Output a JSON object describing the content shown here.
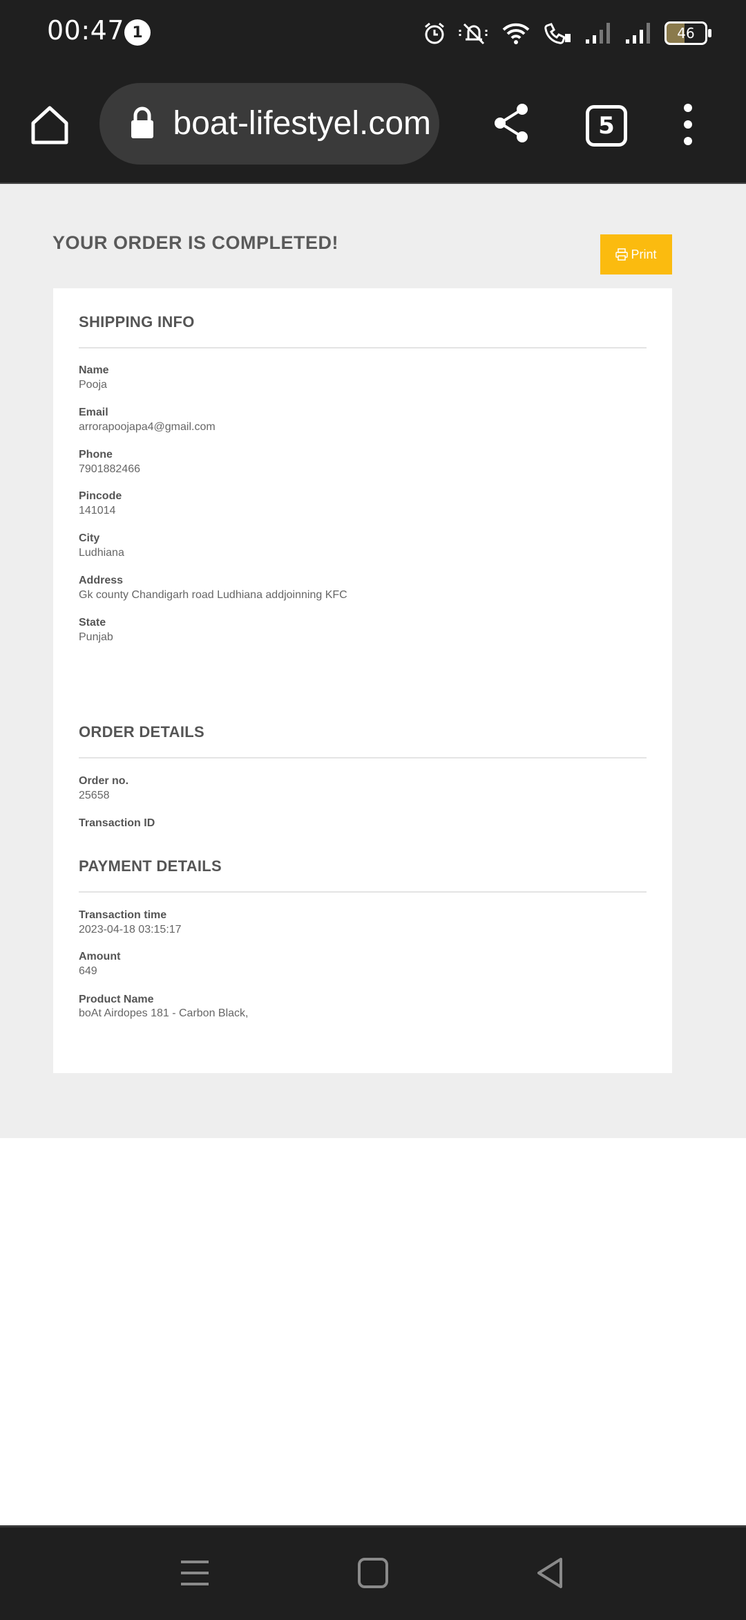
{
  "status_bar": {
    "time": "00:47",
    "notification_count": "1",
    "battery_level": "46",
    "icons": [
      "alarm-icon",
      "mute-icon",
      "wifi-icon",
      "wifi-calling-icon",
      "signal-icon",
      "signal-icon"
    ]
  },
  "browser": {
    "url": "boat-lifestyel.com",
    "tab_count": "5"
  },
  "page": {
    "title": "YOUR ORDER IS COMPLETED!",
    "print_label": "Print",
    "accent_color": "#fbbb0f",
    "shipping": {
      "heading": "SHIPPING INFO",
      "fields": [
        {
          "label": "Name",
          "value": "Pooja"
        },
        {
          "label": "Email",
          "value": "arrorapoojapa4@gmail.com"
        },
        {
          "label": "Phone",
          "value": "7901882466"
        },
        {
          "label": "Pincode",
          "value": "141014"
        },
        {
          "label": "City",
          "value": "Ludhiana"
        },
        {
          "label": "Address",
          "value": "Gk county Chandigarh road Ludhiana addjoinning KFC"
        },
        {
          "label": "State",
          "value": "Punjab"
        }
      ]
    },
    "order": {
      "heading": "ORDER DETAILS",
      "fields": [
        {
          "label": "Order no.",
          "value": "25658"
        },
        {
          "label": "Transaction ID",
          "value": ""
        }
      ]
    },
    "payment": {
      "heading": "PAYMENT DETAILS",
      "fields": [
        {
          "label": "Transaction time",
          "value": "2023-04-18 03:15:17"
        },
        {
          "label": "Amount",
          "value": "649"
        },
        {
          "label": "Product Name",
          "value": "boAt Airdopes 181 - Carbon Black,"
        }
      ]
    }
  }
}
